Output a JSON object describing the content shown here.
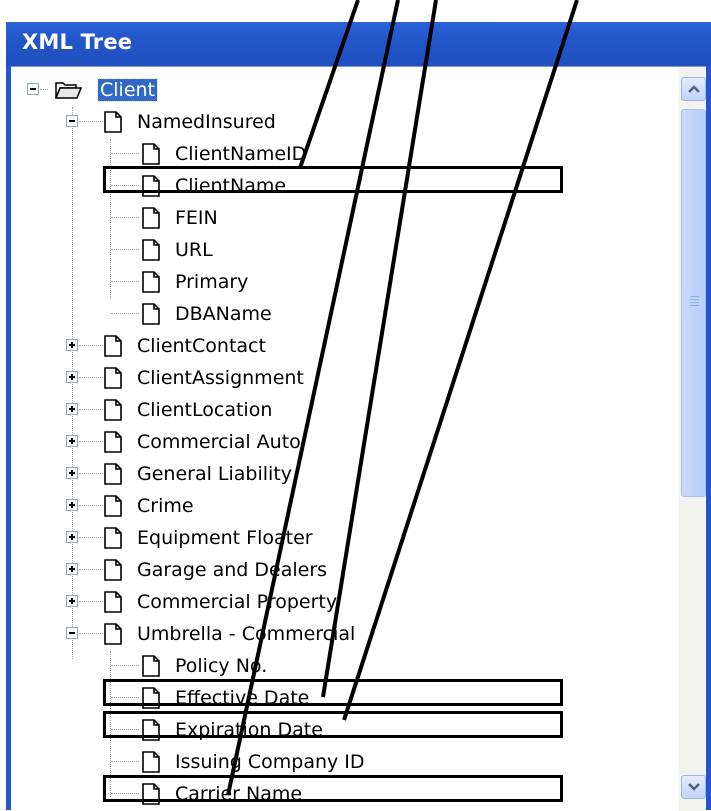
{
  "window": {
    "title": "XML Tree"
  },
  "tree": {
    "root": {
      "label": "Client",
      "icon": "open-folder-icon",
      "expanded": true,
      "selected": true
    },
    "nodes": [
      {
        "label": "NamedInsured",
        "toggle": "collapse"
      },
      {
        "label": "ClientNameID"
      },
      {
        "label": "ClientName",
        "highlighted": true
      },
      {
        "label": "FEIN"
      },
      {
        "label": "URL"
      },
      {
        "label": "Primary"
      },
      {
        "label": "DBAName"
      },
      {
        "label": "ClientContact",
        "toggle": "expand"
      },
      {
        "label": "ClientAssignment",
        "toggle": "expand"
      },
      {
        "label": "ClientLocation",
        "toggle": "expand"
      },
      {
        "label": "Commercial Auto",
        "toggle": "expand"
      },
      {
        "label": "General Liability",
        "toggle": "expand"
      },
      {
        "label": "Crime",
        "toggle": "expand"
      },
      {
        "label": "Equipment Floater",
        "toggle": "expand"
      },
      {
        "label": "Garage and Dealers",
        "toggle": "expand"
      },
      {
        "label": "Commercial Property",
        "toggle": "expand"
      },
      {
        "label": "Umbrella - Commercial",
        "toggle": "collapse"
      },
      {
        "label": "Policy No."
      },
      {
        "label": "Effective Date",
        "highlighted": true
      },
      {
        "label": "Expiration Date",
        "highlighted": true
      },
      {
        "label": "Issuing Company ID"
      },
      {
        "label": "Carrier Name",
        "highlighted": true
      }
    ]
  },
  "scrollbar": {
    "up_icon": "chevron-up-icon",
    "down_icon": "chevron-down-icon",
    "position_fraction": 0.0
  },
  "colors": {
    "title_bar": "#2256c9",
    "selection": "#316ac5",
    "annotation": "#000000"
  }
}
